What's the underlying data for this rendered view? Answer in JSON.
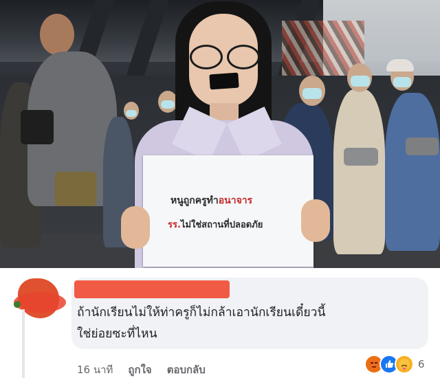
{
  "photo": {
    "sign": {
      "line1_dark": "หนูถูกครูทำ",
      "line1_red": "อนาจาร",
      "line2_red": "รร.",
      "line2_dark": "ไม่ใช่สถานที่ปลอดภัย"
    }
  },
  "comment": {
    "text_line1": "ถ้านักเรียนไม่ให้ท่าครูก็ไม่กล้าเอานักเรียนเดี๋ยวนี้",
    "text_line2": "ใช่ย่อยซะที่ไหน",
    "timestamp": "16 นาที",
    "like_label": "ถูกใจ",
    "reply_label": "ตอบกลับ",
    "reaction_count": "6",
    "reactions": [
      "angry-icon",
      "like-icon",
      "care-icon"
    ]
  },
  "colors": {
    "bubble": "#f0f2f5",
    "redaction": "#f0513b",
    "like": "#1877f2",
    "angry": "#e9710f"
  }
}
